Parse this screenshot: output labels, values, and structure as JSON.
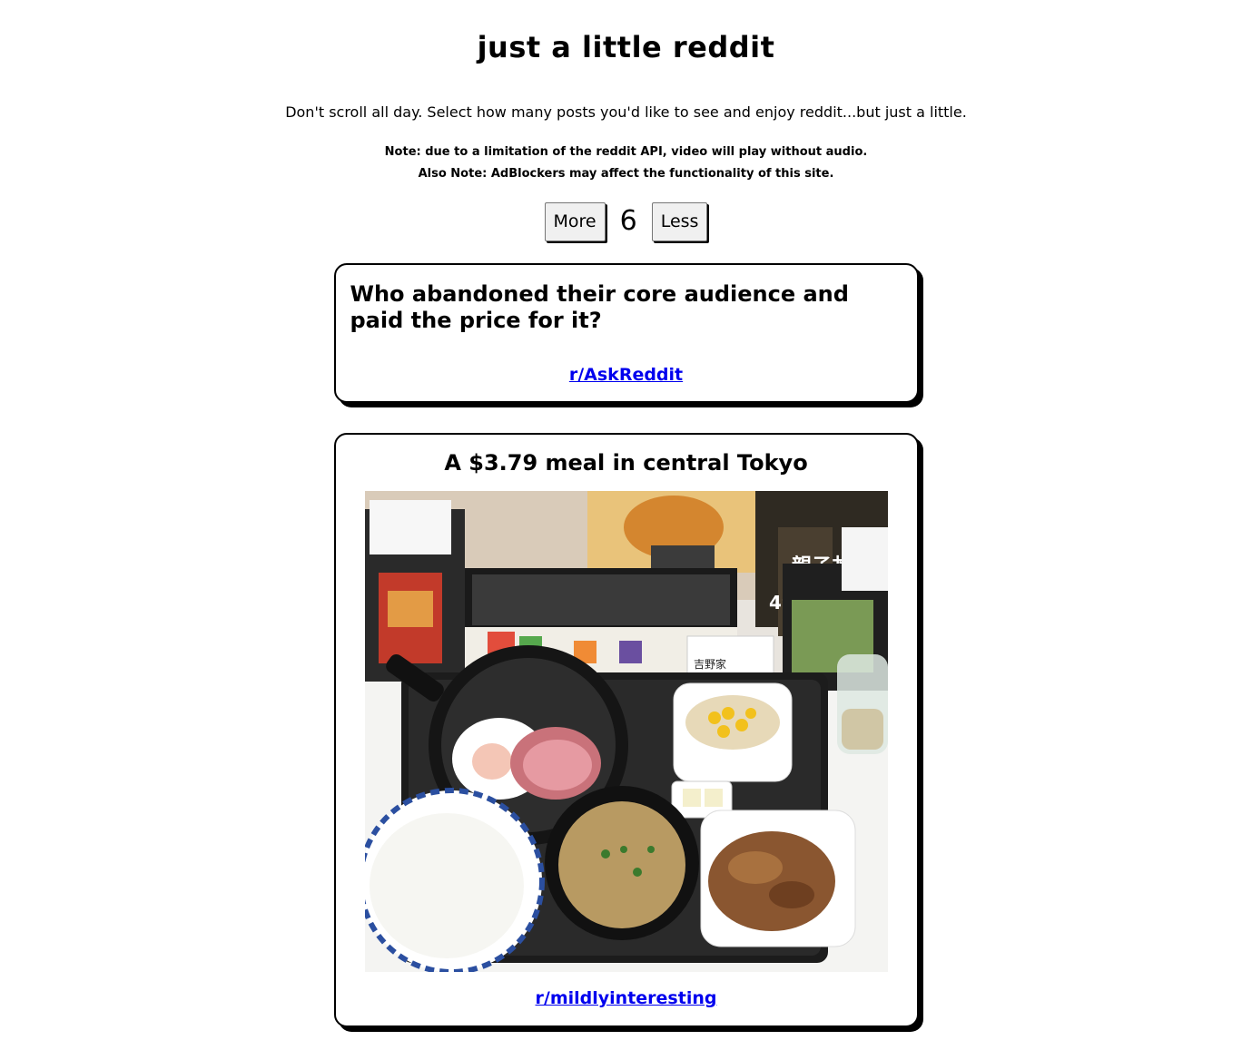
{
  "header": {
    "title": "just a little reddit",
    "tagline": "Don't scroll all day. Select how many posts you'd like to see and enjoy reddit...but just a little.",
    "notes": [
      "Note: due to a limitation of the reddit API, video will play without audio.",
      "Also Note: AdBlockers may affect the functionality of this site."
    ]
  },
  "controls": {
    "more_label": "More",
    "count": "6",
    "less_label": "Less"
  },
  "posts": [
    {
      "title": "Who abandoned their core audience and paid the price for it?",
      "subreddit": "r/AskReddit"
    },
    {
      "title": "A $3.79 meal in central Tokyo",
      "subreddit": "r/mildlyinteresting",
      "image": {
        "sign_text": "親子丼",
        "sign_price": "498円",
        "store_name": "吉野家"
      }
    }
  ]
}
